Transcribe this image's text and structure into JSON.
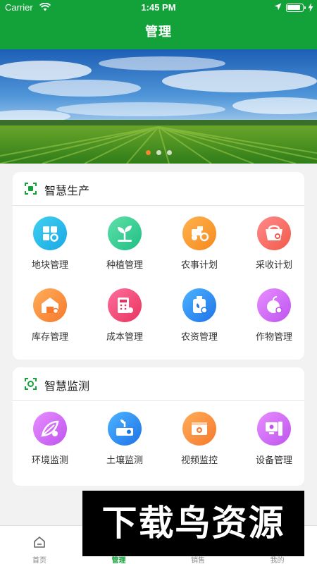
{
  "status": {
    "carrier": "Carrier",
    "time": "1:45 PM",
    "battery_level": 0.9
  },
  "header": {
    "title": "管理"
  },
  "banner": {
    "slide_count": 3,
    "active_slide": 1
  },
  "production": {
    "title": "智慧生产",
    "icon": "production-scan-icon",
    "items": [
      {
        "label": "地块管理",
        "icon": "plot-grid-icon",
        "color_from": "#3fd0f0",
        "color_to": "#1aa8e6"
      },
      {
        "label": "种植管理",
        "icon": "sprout-icon",
        "color_from": "#5fe0a8",
        "color_to": "#1fbf84"
      },
      {
        "label": "农事计划",
        "icon": "tractor-icon",
        "color_from": "#ffb14e",
        "color_to": "#f68a1e"
      },
      {
        "label": "采收计划",
        "icon": "harvest-basket-icon",
        "color_from": "#ff8a8a",
        "color_to": "#f25a4a"
      },
      {
        "label": "库存管理",
        "icon": "warehouse-icon",
        "color_from": "#ffae5a",
        "color_to": "#f6792c"
      },
      {
        "label": "成本管理",
        "icon": "cost-calculator-icon",
        "color_from": "#ff6f9a",
        "color_to": "#e8335f"
      },
      {
        "label": "农资管理",
        "icon": "fertilizer-bottle-icon",
        "color_from": "#4cb3ff",
        "color_to": "#1f73e8"
      },
      {
        "label": "作物管理",
        "icon": "crop-fruit-icon",
        "color_from": "#e88dff",
        "color_to": "#bd54ef"
      }
    ]
  },
  "monitoring": {
    "title": "智慧监测",
    "icon": "monitor-camera-icon",
    "items": [
      {
        "label": "环境监测",
        "icon": "environment-icon",
        "color_from": "#e88dff",
        "color_to": "#bd54ef"
      },
      {
        "label": "土壤监测",
        "icon": "soil-sensor-icon",
        "color_from": "#4cb3ff",
        "color_to": "#1f73e8"
      },
      {
        "label": "视频监控",
        "icon": "video-camera-icon",
        "color_from": "#ffae5a",
        "color_to": "#f6792c"
      },
      {
        "label": "设备管理",
        "icon": "device-computer-icon",
        "color_from": "#e88dff",
        "color_to": "#bd54ef"
      }
    ]
  },
  "tabs": [
    {
      "label": "首页",
      "icon": "home-icon"
    },
    {
      "label": "管理",
      "icon": "manage-icon"
    },
    {
      "label": "销售",
      "icon": "sales-icon"
    },
    {
      "label": "我的",
      "icon": "profile-icon"
    }
  ],
  "active_tab": 1,
  "watermark": {
    "text": "下载鸟资源"
  },
  "colors": {
    "primary": "#13a23a",
    "accent": "#f08a2a"
  }
}
